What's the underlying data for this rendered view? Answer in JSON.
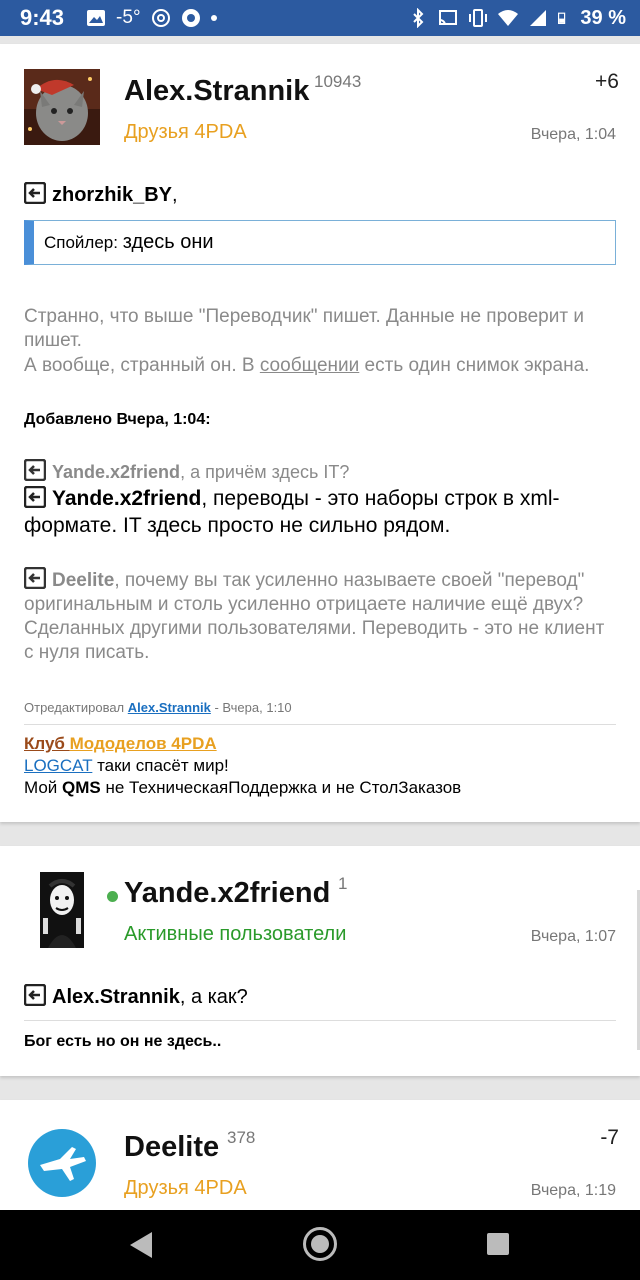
{
  "status_bar": {
    "time": "9:43",
    "temperature": "-5°",
    "battery": "39 %"
  },
  "posts": [
    {
      "author": "Alex.Strannik",
      "reputation": "10943",
      "group": "Друзья 4PDA",
      "karma": "+6",
      "time": "Вчера, 1:04",
      "reply_to": "zhorzhik_BY",
      "reply_suffix": ",",
      "spoiler_label": "Спойлер:",
      "spoiler_value": "здесь они",
      "para1": "Странно, что выше \"Переводчик\" пишет. Данные не проверит и пишет.",
      "para2_a": "А вообще, странный он. В ",
      "para2_link": "сообщении",
      "para2_b": " есть один снимок экрана.",
      "added": "Добавлено Вчера, 1:04:",
      "q1_name": "Yande.x2friend",
      "q1_text": ", а причём здесь IT?",
      "q2_name": "Yande.x2friend",
      "q2_text": ", переводы - это наборы строк в xml-формате. IT здесь просто не сильно рядом.",
      "q3_name": "Deelite",
      "q3_text": ", почему вы так усиленно называете своей \"перевод\" оригинальным и столь усиленно отрицаете наличие ещё двух? Сделанных другими пользователями. Переводить - это не клиент с нуля писать.",
      "edited_prefix": "Отредактировал ",
      "edited_by": "Alex.Strannik",
      "edited_suffix": " - Вчера, 1:10",
      "sig_club_a": "Клуб ",
      "sig_club_b": "Мододелов 4PDA",
      "sig2_link": "LOGCAT",
      "sig2_text": " таки спасёт мир!",
      "sig3_a": "Мой ",
      "sig3_b": "QMS",
      "sig3_c": " не ТехническаяПоддержка и не СтолЗаказов"
    },
    {
      "author": "Yande.x2friend",
      "reputation": "1",
      "group": "Активные пользователи",
      "time": "Вчера, 1:07",
      "reply_to": "Alex.Strannik",
      "reply_suffix": ", а как?",
      "signature": "Бог есть но он не здесь.."
    },
    {
      "author": "Deelite",
      "reputation": "378",
      "group": "Друзья 4PDA",
      "karma": "-7",
      "time": "Вчера, 1:19"
    }
  ],
  "colors": {
    "status_bar": "#2c5aa0",
    "friends_group": "#e8a020",
    "active_group": "#2a9a2a",
    "link": "#1a6fc0",
    "club_brown": "#9a4a1a",
    "online_dot": "#4caf50"
  },
  "icons": [
    "picture-icon",
    "weather-icon",
    "camera-icon",
    "bluetooth-icon",
    "cast-icon",
    "vibrate-icon",
    "wifi-icon",
    "signal-icon",
    "battery-icon",
    "quote-icon"
  ]
}
